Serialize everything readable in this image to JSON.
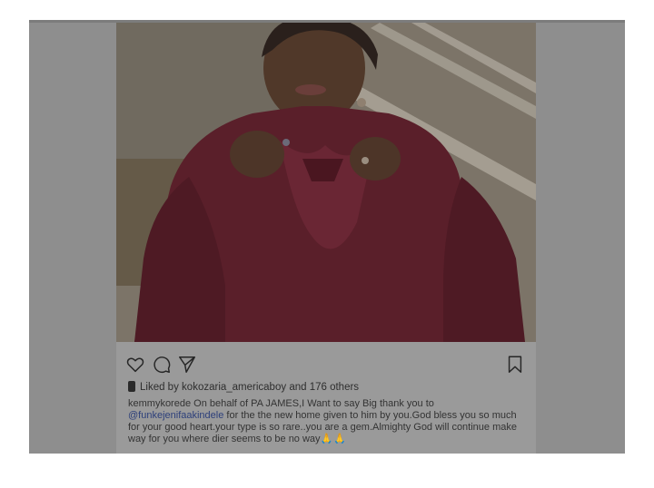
{
  "post": {
    "liked_prefix": "Liked by",
    "liked_user": "kokozaria_americaboy",
    "liked_suffix": "and 176 others",
    "caption_user": "kemmykorede",
    "caption_part1": "On behalf of PA JAMES,I Want to say Big thank you to",
    "caption_mention": "@funkejenifaakindele",
    "caption_part2": "for the the new home given to him by you.God bless you so much for your good heart.your type is so rare..you are a gem.Almighty God will continue make way for you where dier seems to be no way",
    "caption_emojis": "🙏🙏"
  },
  "icons": {
    "like": "heart-icon",
    "comment": "comment-icon",
    "share": "send-icon",
    "save": "bookmark-icon"
  },
  "colors": {
    "overlay": "#8e8e8e",
    "dress": "#5a1f2a",
    "mention": "#2c3f7a"
  }
}
